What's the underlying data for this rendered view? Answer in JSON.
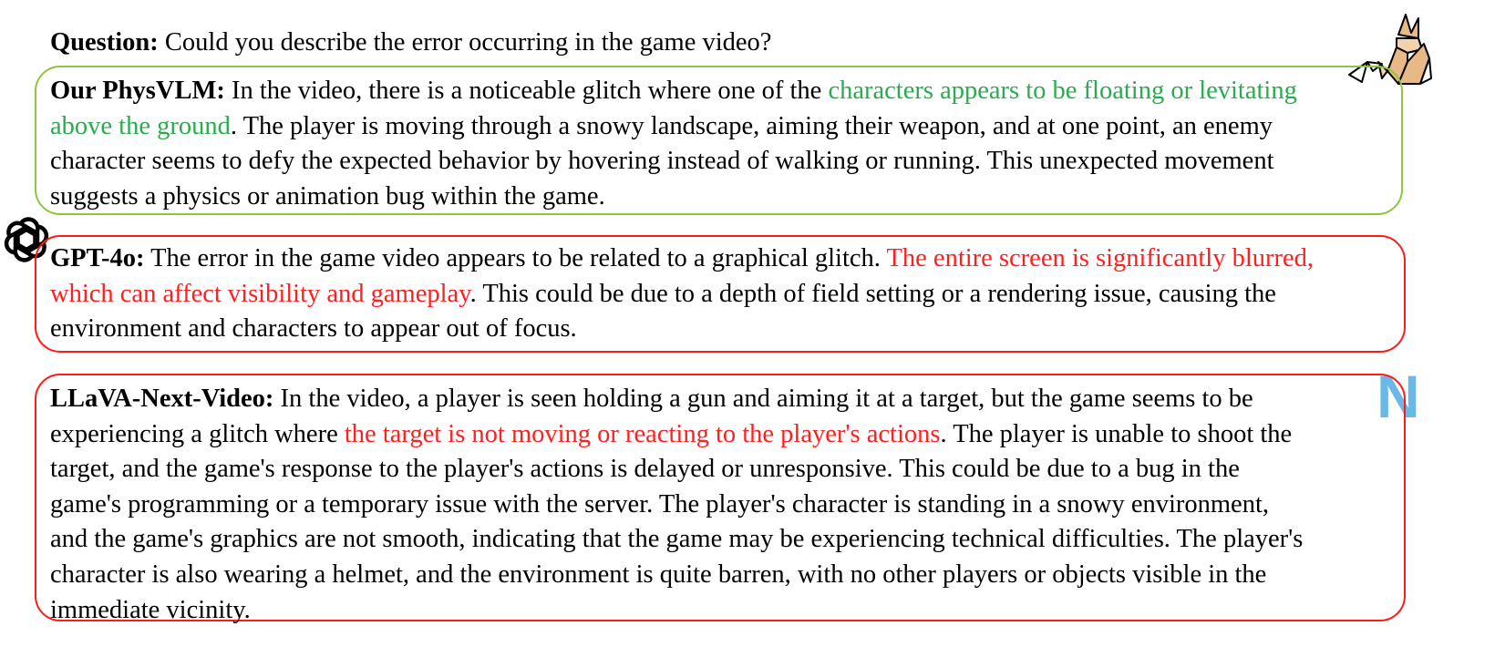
{
  "question": {
    "label": "Question:",
    "text": " Could you describe the error occurring in the game video?"
  },
  "answers": [
    {
      "model": "Our PhysVLM:",
      "verdict_color": "#8cc63f",
      "highlight_color": "#2bab4f",
      "lines": [
        {
          "pre": " In the video, there is a noticeable glitch where one of the ",
          "hl": "characters appears to be floating or levitating",
          "post": ""
        },
        {
          "pre": "",
          "hl": "above the ground",
          "post": ". The player is moving through a snowy landscape, aiming their weapon, and at one point, an enemy"
        },
        {
          "pre": "character seems to defy the expected behavior by hovering instead of walking or running. This unexpected movement",
          "hl": "",
          "post": ""
        },
        {
          "pre": "suggests a physics or animation bug within the game.",
          "hl": "",
          "post": ""
        }
      ]
    },
    {
      "model": "GPT-4o:",
      "verdict_color": "#ff1a1a",
      "highlight_color": "#ff1f1f",
      "lines": [
        {
          "pre": " The error in the game video appears to be related to a graphical glitch. ",
          "hl": "The entire screen is significantly blurred,",
          "post": ""
        },
        {
          "pre": "",
          "hl": "which can affect visibility and gameplay",
          "post": ". This could be due to a depth of field setting or a rendering issue, causing the"
        },
        {
          "pre": "environment and characters to appear out of focus.",
          "hl": "",
          "post": ""
        }
      ]
    },
    {
      "model": "LLaVA-Next-Video:",
      "verdict_color": "#ff1a1a",
      "highlight_color": "#ff1f1f",
      "lines": [
        {
          "pre": " In the video, a player is seen holding a gun and aiming it at a target, but the game seems to be",
          "hl": "",
          "post": ""
        },
        {
          "pre": "experiencing a glitch where ",
          "hl": "the target is not moving or reacting to the player's actions",
          "post": ". The player is unable to shoot the"
        },
        {
          "pre": "target, and the game's response to the player's actions is delayed or unresponsive. This could be due to a bug in the",
          "hl": "",
          "post": ""
        },
        {
          "pre": "game's programming or a temporary issue with the server. The player's character is standing in a snowy environment,",
          "hl": "",
          "post": ""
        },
        {
          "pre": "and the game's graphics are not smooth, indicating that the game may be experiencing technical difficulties. The player's",
          "hl": "",
          "post": ""
        },
        {
          "pre": "character is also wearing a helmet, and the environment is quite barren, with no other players or objects visible in the",
          "hl": "",
          "post": ""
        },
        {
          "pre": "immediate vicinity.",
          "hl": "",
          "post": ""
        }
      ]
    }
  ],
  "logos": {
    "physvlm": "fox-logo",
    "gpt4o": "openai-knot-logo",
    "llava": "N"
  }
}
